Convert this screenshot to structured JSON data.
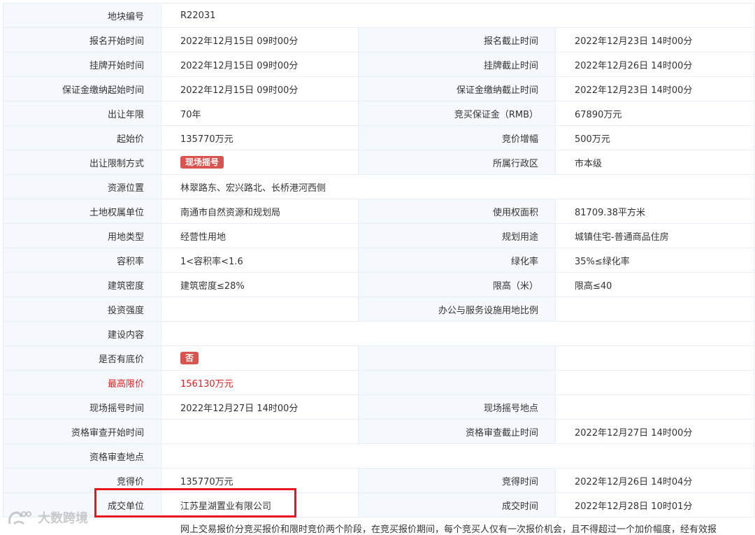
{
  "rows": [
    {
      "l1": "地块编号",
      "v1": "R22031",
      "wide": true
    },
    {
      "l1": "报名开始时间",
      "v1": "2022年12月15日 09时00分",
      "l2": "报名截止时间",
      "v2": "2022年12月23日 14时00分"
    },
    {
      "l1": "挂牌开始时间",
      "v1": "2022年12月15日 09时00分",
      "l2": "挂牌截止时间",
      "v2": "2022年12月26日 14时00分"
    },
    {
      "l1": "保证金缴纳起始时间",
      "v1": "2022年12月15日 09时00分",
      "l2": "保证金缴纳截止时间",
      "v2": "2022年12月23日 14时00分"
    },
    {
      "l1": "出让年限",
      "v1": "70年",
      "l2": "竞买保证金（RMB）",
      "v2": "67890万元"
    },
    {
      "l1": "起始价",
      "v1": "135770万元",
      "l2": "竞价增幅",
      "v2": "500万元"
    },
    {
      "l1": "出让限制方式",
      "v1": "现场摇号",
      "v1_tag": true,
      "l2": "所属行政区",
      "v2": "市本级"
    },
    {
      "l1": "资源位置",
      "v1": "林翠路东、宏兴路北、长桥港河西侧",
      "wide": true
    },
    {
      "l1": "土地权属单位",
      "v1": "南通市自然资源和规划局",
      "l2": "使用权面积",
      "v2": "81709.38平方米"
    },
    {
      "l1": "用地类型",
      "v1": "经营性用地",
      "l2": "规划用途",
      "v2": "城镇住宅-普通商品住房"
    },
    {
      "l1": "容积率",
      "v1": "1<容积率<1.6",
      "l2": "绿化率",
      "v2": "35%≤绿化率"
    },
    {
      "l1": "建筑密度",
      "v1": "建筑密度≤28%",
      "l2": "限高（米）",
      "v2": "限高≤40"
    },
    {
      "l1": "投资强度",
      "v1": "",
      "l2": "办公与服务设施用地比例",
      "v2": ""
    },
    {
      "l1": "建设内容",
      "v1": "",
      "wide": true
    },
    {
      "l1": "是否有底价",
      "v1": "否",
      "v1_tag": true,
      "l2": "",
      "v2": ""
    },
    {
      "l1": "最高限价",
      "v1": "156130万元",
      "red": true,
      "l2": "",
      "v2": ""
    },
    {
      "l1": "现场摇号时间",
      "v1": "2022年12月27日 14时00分",
      "l2": "现场摇号地点",
      "v2": ""
    },
    {
      "l1": "资格审查开始时间",
      "v1": "",
      "l2": "资格审查截止时间",
      "v2": "2022年12月27日 14时00分"
    },
    {
      "l1": "资格审查地点",
      "v1": "",
      "wide": true
    },
    {
      "l1": "竞得价",
      "v1": "135770万元",
      "l2": "竞得时间",
      "v2": "2022年12月26日 14时04分"
    },
    {
      "l1": "成交单位",
      "v1": "江苏星湖置业有限公司",
      "l2": "成交时间",
      "v2": "2022年12月28日 10时01分"
    }
  ],
  "notice_text": "网上交易报价分竞买报价和限时竞价两个阶段，在竞买报价期间，每个竞买人仅有一次报价机会，且不得超过一个加价幅度，经有效报",
  "watermark_text": "大数跨境",
  "colors": {
    "label_bg": "#f5f9fd",
    "border": "#e8eef5",
    "tag_bg": "#d9534f",
    "highlight": "#e8141e",
    "red_text": "#e02020"
  }
}
